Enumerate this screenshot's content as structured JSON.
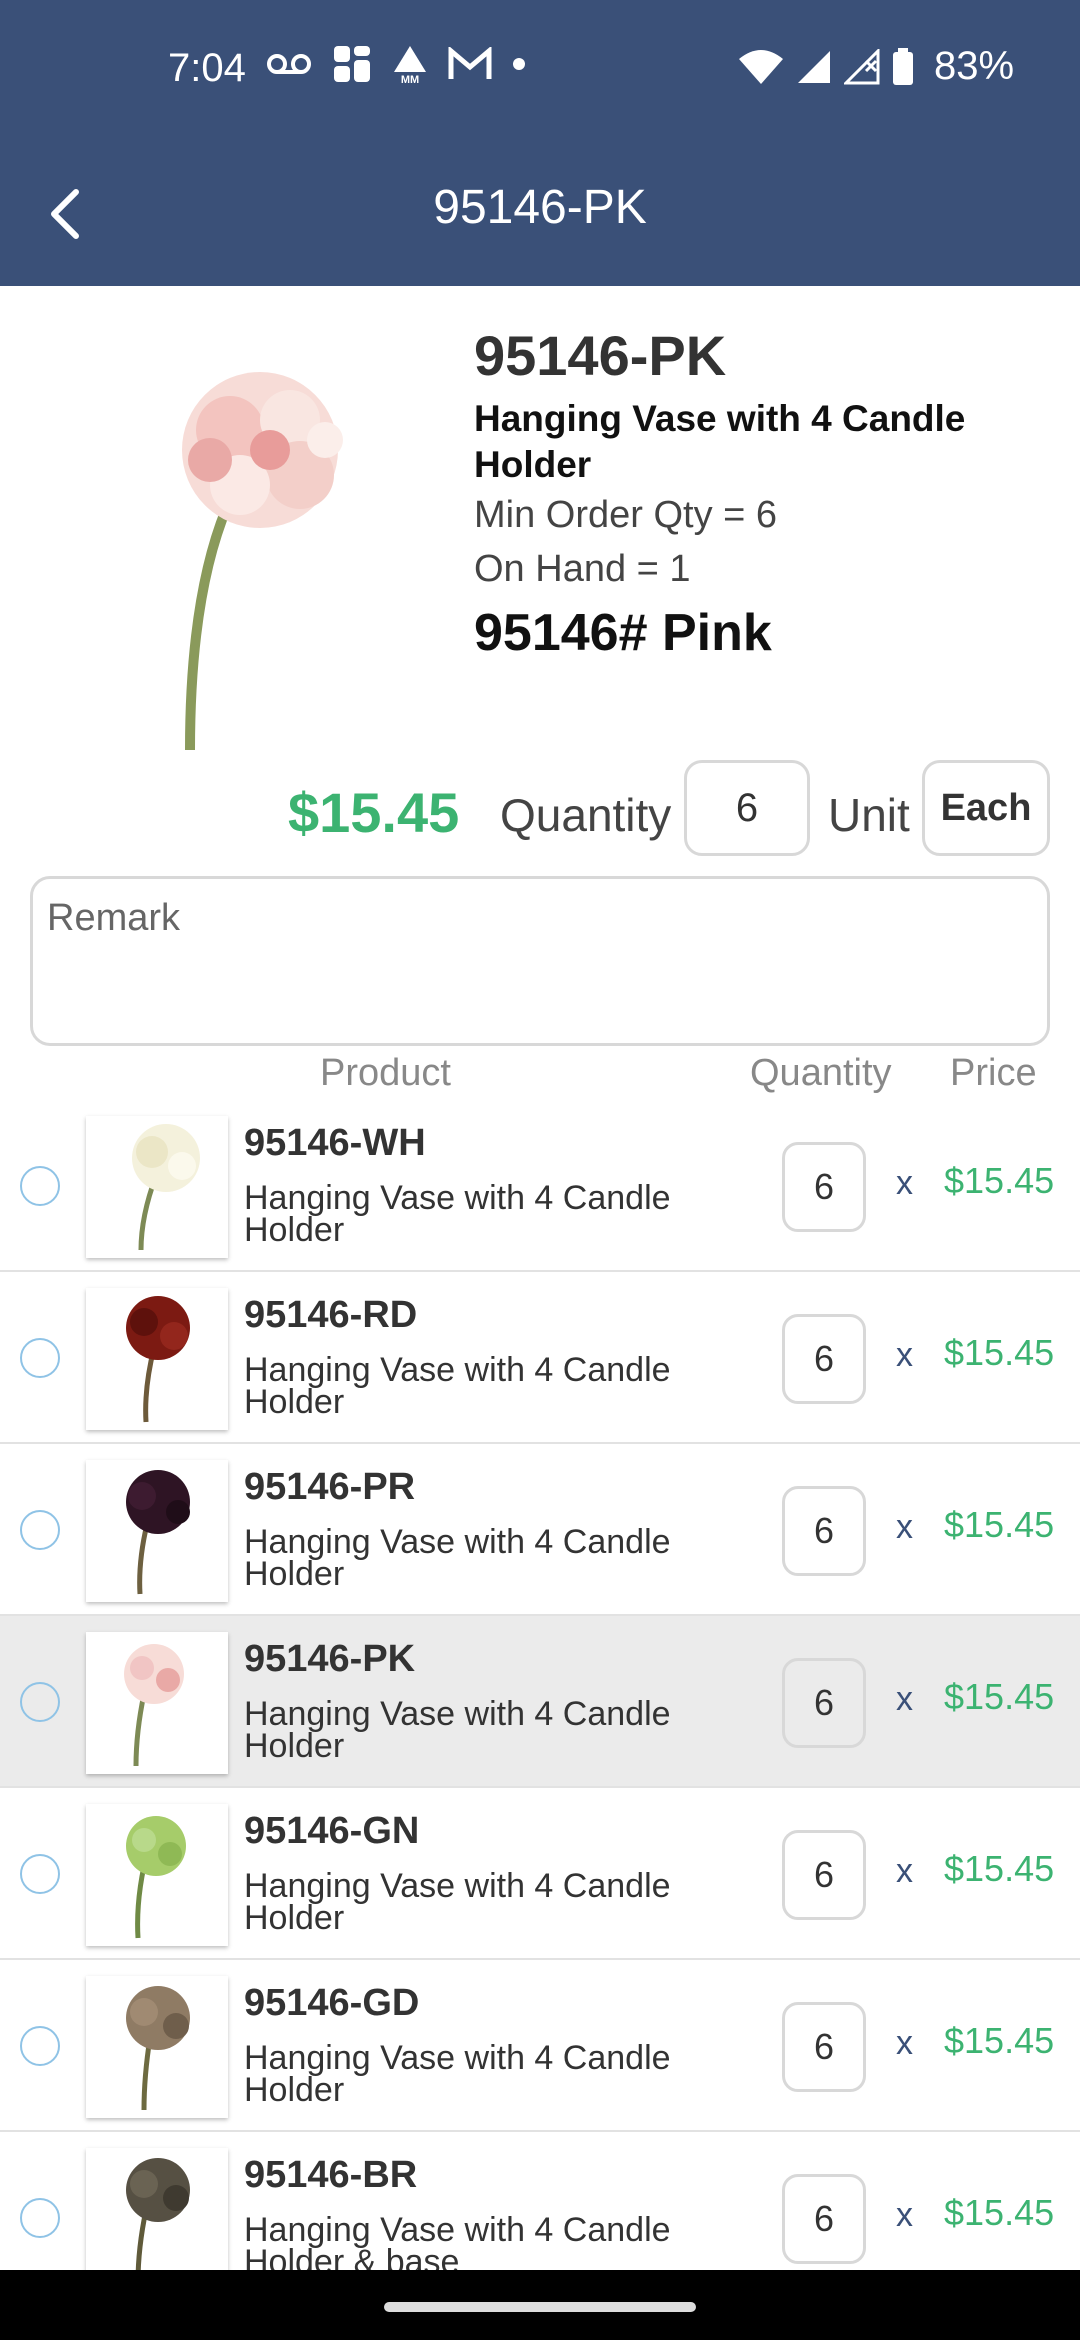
{
  "status_bar": {
    "time": "7:04",
    "battery": "83%",
    "icons": [
      "voicemail-icon",
      "app-icon",
      "mm-icon",
      "gmail-icon",
      "dot-icon",
      "wifi-icon",
      "signal-icon",
      "signal-x-icon",
      "battery-icon"
    ]
  },
  "header": {
    "title": "95146-PK",
    "back_icon": "back-arrow-icon"
  },
  "product": {
    "code": "95146-PK",
    "name": "Hanging Vase with 4 Candle Holder",
    "min_order": "Min Order Qty = 6",
    "on_hand": "On Hand = 1",
    "variant": "95146#  Pink",
    "price": "$15.45",
    "quantity_label": "Quantity",
    "quantity": "6",
    "unit_label": "Unit",
    "unit": "Each"
  },
  "remark": {
    "placeholder": "Remark"
  },
  "columns": {
    "product": "Product",
    "quantity": "Quantity",
    "price": "Price"
  },
  "items": [
    {
      "code": "95146-WH",
      "name": "Hanging Vase with 4 Candle Holder",
      "qty": "6",
      "x": "x",
      "price": "$15.45",
      "color": "#f4f1dc",
      "stem": "#7d8a55"
    },
    {
      "code": "95146-RD",
      "name": "Hanging Vase with 4 Candle Holder",
      "qty": "6",
      "x": "x",
      "price": "$15.45",
      "color": "#7c1a12",
      "stem": "#6d5a3a"
    },
    {
      "code": "95146-PR",
      "name": "Hanging Vase with 4 Candle Holder",
      "qty": "6",
      "x": "x",
      "price": "$15.45",
      "color": "#2e1424",
      "stem": "#6d6040"
    },
    {
      "code": "95146-PK",
      "name": "Hanging Vase with 4 Candle Holder",
      "qty": "6",
      "x": "x",
      "price": "$15.45",
      "color": "#f1c5c4",
      "stem": "#7d8a55"
    },
    {
      "code": "95146-GN",
      "name": "Hanging Vase with 4 Candle Holder",
      "qty": "6",
      "x": "x",
      "price": "$15.45",
      "color": "#a6cc6a",
      "stem": "#6f8a45"
    },
    {
      "code": "95146-GD",
      "name": "Hanging Vase with 4 Candle Holder",
      "qty": "6",
      "x": "x",
      "price": "$15.45",
      "color": "#8f7b64",
      "stem": "#6d6a40"
    },
    {
      "code": "95146-BR",
      "name": "Hanging Vase with 4 Candle Holder & base",
      "qty": "6",
      "x": "x",
      "price": "$15.45",
      "color": "#565043",
      "stem": "#5f5a3a"
    }
  ],
  "colors": {
    "header": "#3a5078",
    "price": "#3cb371",
    "selected_row": "#ebebeb"
  }
}
